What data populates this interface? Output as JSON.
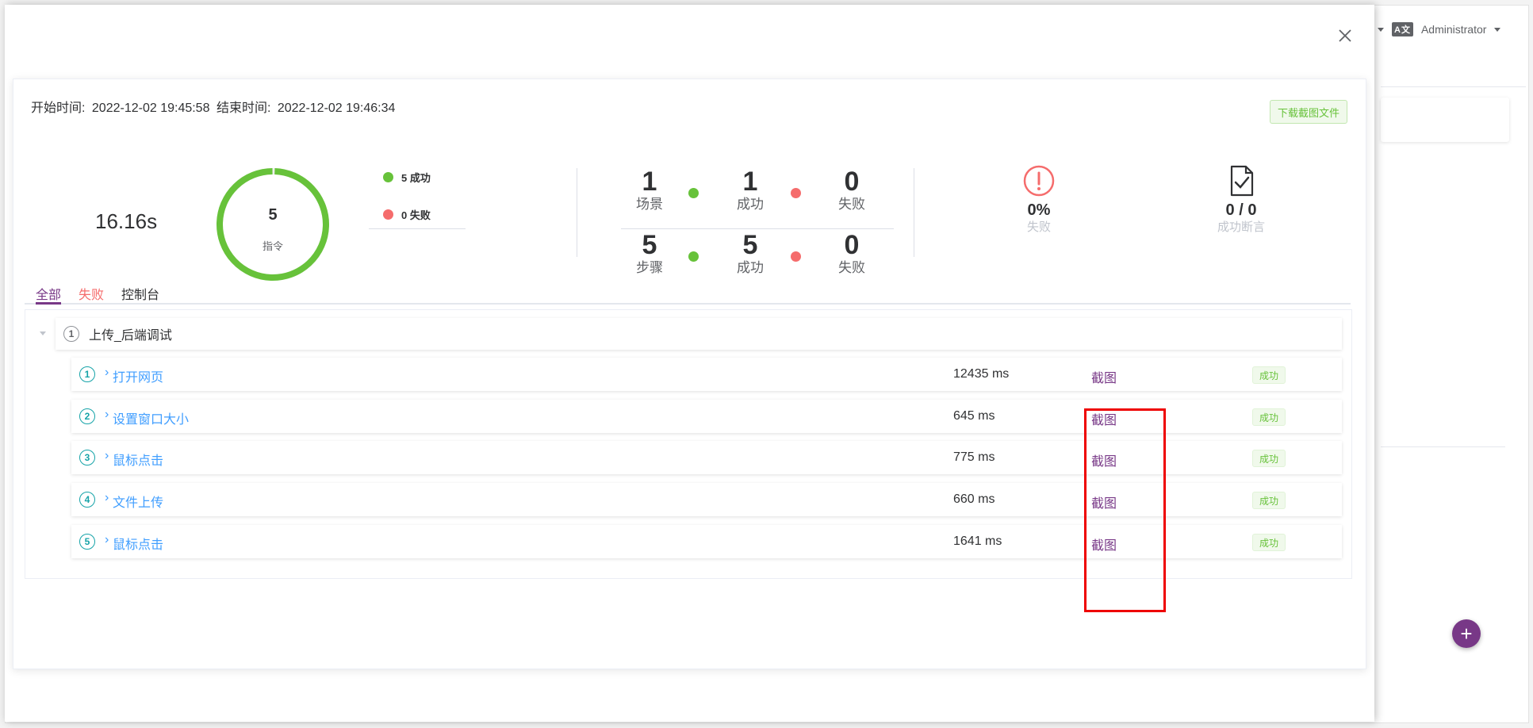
{
  "topbar": {
    "user": "Administrator"
  },
  "header": {
    "start_label": "开始时间:",
    "start_time": "2022-12-02 19:45:58",
    "end_label": "结束时间:",
    "end_time": "2022-12-02 19:46:34",
    "download_button": "下载截图文件"
  },
  "summary": {
    "duration": "16.16s",
    "commands_count": "5",
    "commands_label": "指令",
    "commands_success_ratio": 1.0,
    "legend_success": "5 成功",
    "legend_fail": "0 失败",
    "scenario_count": "1",
    "scenario_label": "场景",
    "scenario_success": "1",
    "scenario_success_label": "成功",
    "scenario_fail": "0",
    "scenario_fail_label": "失败",
    "step_count": "5",
    "step_label": "步骤",
    "step_success": "5",
    "step_success_label": "成功",
    "step_fail": "0",
    "step_fail_label": "失败",
    "fail_rate": "0%",
    "fail_rate_label": "失败",
    "assertions": "0 / 0",
    "assertions_label": "成功断言"
  },
  "tabs": {
    "all": "全部",
    "fail": "失败",
    "console": "控制台"
  },
  "scenario": {
    "index": "1",
    "name": "上传_后端调试"
  },
  "steps": [
    {
      "index": "1",
      "name": "打开网页",
      "time": "12435 ms",
      "screenshot": "截图",
      "status": "成功"
    },
    {
      "index": "2",
      "name": "设置窗口大小",
      "time": "645 ms",
      "screenshot": "截图",
      "status": "成功"
    },
    {
      "index": "3",
      "name": "鼠标点击",
      "time": "775 ms",
      "screenshot": "截图",
      "status": "成功"
    },
    {
      "index": "4",
      "name": "文件上传",
      "time": "660 ms",
      "screenshot": "截图",
      "status": "成功"
    },
    {
      "index": "5",
      "name": "鼠标点击",
      "time": "1641 ms",
      "screenshot": "截图",
      "status": "成功"
    }
  ],
  "colors": {
    "accent": "#783887",
    "success": "#67c23a",
    "danger": "#f56c6c",
    "link": "#409eff",
    "annotation_box": "#ee0000"
  },
  "icons": {
    "close": "close-icon",
    "fail_rate": "exclamation-circle-icon",
    "assertions": "document-check-icon",
    "fab": "plus-icon"
  }
}
